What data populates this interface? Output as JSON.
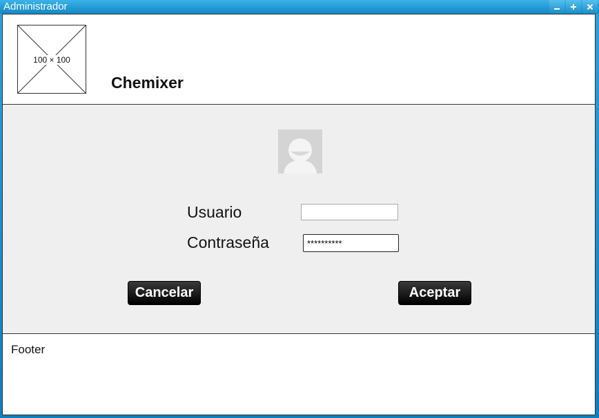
{
  "window": {
    "title": "Administrador",
    "controls": [
      "minimize-icon",
      "maximize-icon",
      "close-icon"
    ],
    "accent_color": "#1a8fc9"
  },
  "header": {
    "logo_placeholder": "100 × 100",
    "brand": "Chemixer"
  },
  "login": {
    "avatar_icon": "user-avatar-icon",
    "username_label": "Usuario",
    "username_value": "",
    "password_label": "Contraseña",
    "password_value": "**********",
    "cancel_label": "Cancelar",
    "accept_label": "Aceptar"
  },
  "footer": {
    "text": "Footer"
  }
}
